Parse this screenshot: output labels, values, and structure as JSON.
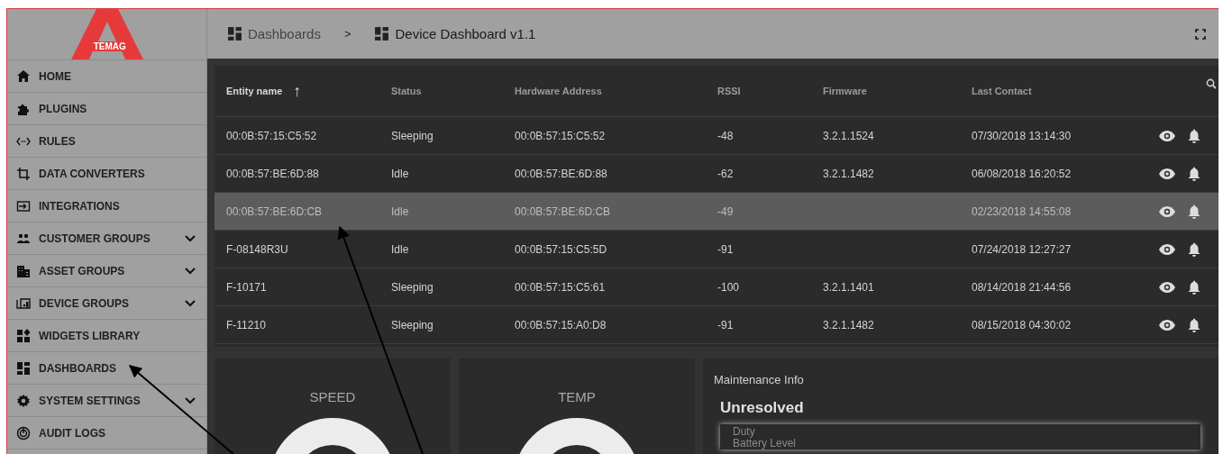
{
  "logo": {
    "text": "TEMAG"
  },
  "sidebar": {
    "items": [
      {
        "label": "HOME",
        "kind": "link"
      },
      {
        "label": "PLUGINS",
        "kind": "link"
      },
      {
        "label": "RULES",
        "kind": "link"
      },
      {
        "label": "DATA CONVERTERS",
        "kind": "link"
      },
      {
        "label": "INTEGRATIONS",
        "kind": "link"
      },
      {
        "label": "CUSTOMER GROUPS",
        "kind": "group"
      },
      {
        "label": "ASSET GROUPS",
        "kind": "group"
      },
      {
        "label": "DEVICE GROUPS",
        "kind": "group"
      },
      {
        "label": "WIDGETS LIBRARY",
        "kind": "link"
      },
      {
        "label": "DASHBOARDS",
        "kind": "link"
      },
      {
        "label": "SYSTEM SETTINGS",
        "kind": "group"
      },
      {
        "label": "AUDIT LOGS",
        "kind": "link"
      }
    ]
  },
  "breadcrumb": [
    {
      "label": "Dashboards",
      "current": false
    },
    {
      "label": ">",
      "kind": "separator"
    },
    {
      "label": "Device Dashboard v1.1",
      "current": true
    }
  ],
  "table": {
    "columns": [
      "Entity name",
      "Status",
      "Hardware Address",
      "RSSI",
      "Firmware",
      "Last Contact"
    ],
    "sort_arrow": "↑",
    "rows": [
      {
        "cells": [
          "00:0B:57:15:C5:52",
          "Sleeping",
          "00:0B:57:15:C5:52",
          "-48",
          "3.2.1.1524",
          "07/30/2018 13:14:30"
        ],
        "selected": false
      },
      {
        "cells": [
          "00:0B:57:BE:6D:88",
          "Idle",
          "00:0B:57:BE:6D:88",
          "-62",
          "3.2.1.1482",
          "06/08/2018 16:20:52"
        ],
        "selected": false
      },
      {
        "cells": [
          "00:0B:57:BE:6D:CB",
          "Idle",
          "00:0B:57:BE:6D:CB",
          "-49",
          "",
          "02/23/2018 14:55:08"
        ],
        "selected": true
      },
      {
        "cells": [
          "F-08148R3U",
          "Idle",
          "00:0B:57:15:C5:5D",
          "-91",
          "",
          "07/24/2018 12:27:27"
        ],
        "selected": false
      },
      {
        "cells": [
          "F-10171",
          "Sleeping",
          "00:0B:57:15:C5:61",
          "-100",
          "3.2.1.1401",
          "08/14/2018 21:44:56"
        ],
        "selected": false
      },
      {
        "cells": [
          "F-11210",
          "Sleeping",
          "00:0B:57:15:A0:D8",
          "-91",
          "3.2.1.1482",
          "08/15/2018 04:30:02"
        ],
        "selected": false
      }
    ]
  },
  "gauges": [
    {
      "title": "SPEED"
    },
    {
      "title": "TEMP"
    }
  ],
  "maintenance": {
    "title": "Maintenance Info",
    "heading": "Unresolved",
    "items": [
      "Duty",
      "Battery Level"
    ]
  }
}
